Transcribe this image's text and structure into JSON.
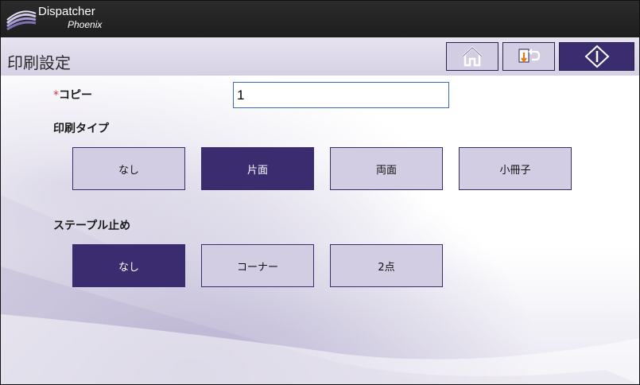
{
  "header": {
    "brand_name": "Dispatcher",
    "brand_sub": "Phoenix",
    "logo_icon": "dispatcher-swoosh-logo"
  },
  "titlebar": {
    "title": "印刷設定",
    "buttons": [
      {
        "name": "home-button",
        "icon": "home-icon"
      },
      {
        "name": "back-button",
        "icon": "return-icon"
      },
      {
        "name": "start-button",
        "icon": "start-diamond-icon"
      }
    ]
  },
  "copies": {
    "required_mark": "*",
    "label": "コピー",
    "value": "1"
  },
  "print_type": {
    "label": "印刷タイプ",
    "options": [
      "なし",
      "片面",
      "両面",
      "小冊子"
    ],
    "selected": "片面"
  },
  "staple": {
    "label": "ステープル止め",
    "options": [
      "なし",
      "コーナー",
      "2点"
    ],
    "selected": "なし"
  },
  "colors": {
    "accent_dark": "#3a2c6e",
    "accent_light": "#d3cde3",
    "topbar": "#232323",
    "required": "#e0342f"
  }
}
